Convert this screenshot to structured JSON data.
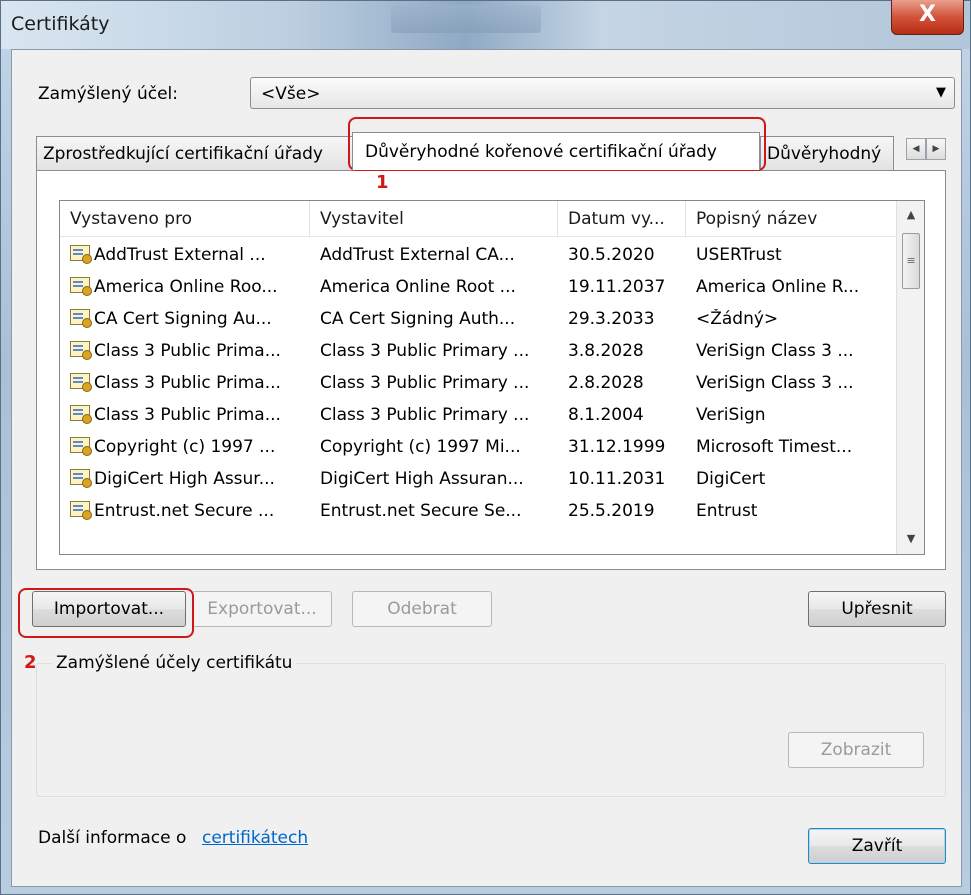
{
  "window": {
    "title": "Certifikáty",
    "close_glyph": "X"
  },
  "purpose": {
    "label": "Zamýšlený účel:",
    "value": "<Vše>"
  },
  "tabs": [
    {
      "label": "Zprostředkující certifikační úřady"
    },
    {
      "label": "Důvěryhodné kořenové certifikační úřady"
    },
    {
      "label": "Důvěryhodný"
    }
  ],
  "list": {
    "columns": [
      "Vystaveno pro",
      "Vystavitel",
      "Datum vy...",
      "Popisný název"
    ],
    "rows": [
      [
        "AddTrust External ...",
        "AddTrust External CA...",
        "30.5.2020",
        "USERTrust"
      ],
      [
        "America Online Roo...",
        "America Online Root ...",
        "19.11.2037",
        "America Online R..."
      ],
      [
        "CA Cert Signing Au...",
        "CA Cert Signing Auth...",
        "29.3.2033",
        "<Žádný>"
      ],
      [
        "Class 3 Public Prima...",
        "Class 3 Public Primary ...",
        "3.8.2028",
        "VeriSign Class 3 ..."
      ],
      [
        "Class 3 Public Prima...",
        "Class 3 Public Primary ...",
        "2.8.2028",
        "VeriSign Class 3 ..."
      ],
      [
        "Class 3 Public Prima...",
        "Class 3 Public Primary ...",
        "8.1.2004",
        "VeriSign"
      ],
      [
        "Copyright (c) 1997 ...",
        "Copyright (c) 1997 Mi...",
        "31.12.1999",
        "Microsoft Timest..."
      ],
      [
        "DigiCert High Assur...",
        "DigiCert High Assuran...",
        "10.11.2031",
        "DigiCert"
      ],
      [
        "Entrust.net Secure ...",
        "Entrust.net Secure Se...",
        "25.5.2019",
        "Entrust"
      ]
    ]
  },
  "buttons": {
    "import": "Importovat...",
    "export": "Exportovat...",
    "remove": "Odebrat",
    "advanced": "Upřesnit",
    "view": "Zobrazit",
    "close": "Zavřít"
  },
  "group": {
    "title": "Zamýšlené účely certifikátu"
  },
  "footer": {
    "text": "Další informace o ",
    "link": "certifikátech"
  },
  "annotations": {
    "marker1": "1",
    "marker2": "2",
    "color": "#d01818"
  },
  "icons": [
    "certificate-icon",
    "close-icon",
    "dropdown-arrow-icon",
    "scroll-left-icon",
    "scroll-right-icon",
    "scroll-up-icon",
    "scroll-down-icon"
  ]
}
